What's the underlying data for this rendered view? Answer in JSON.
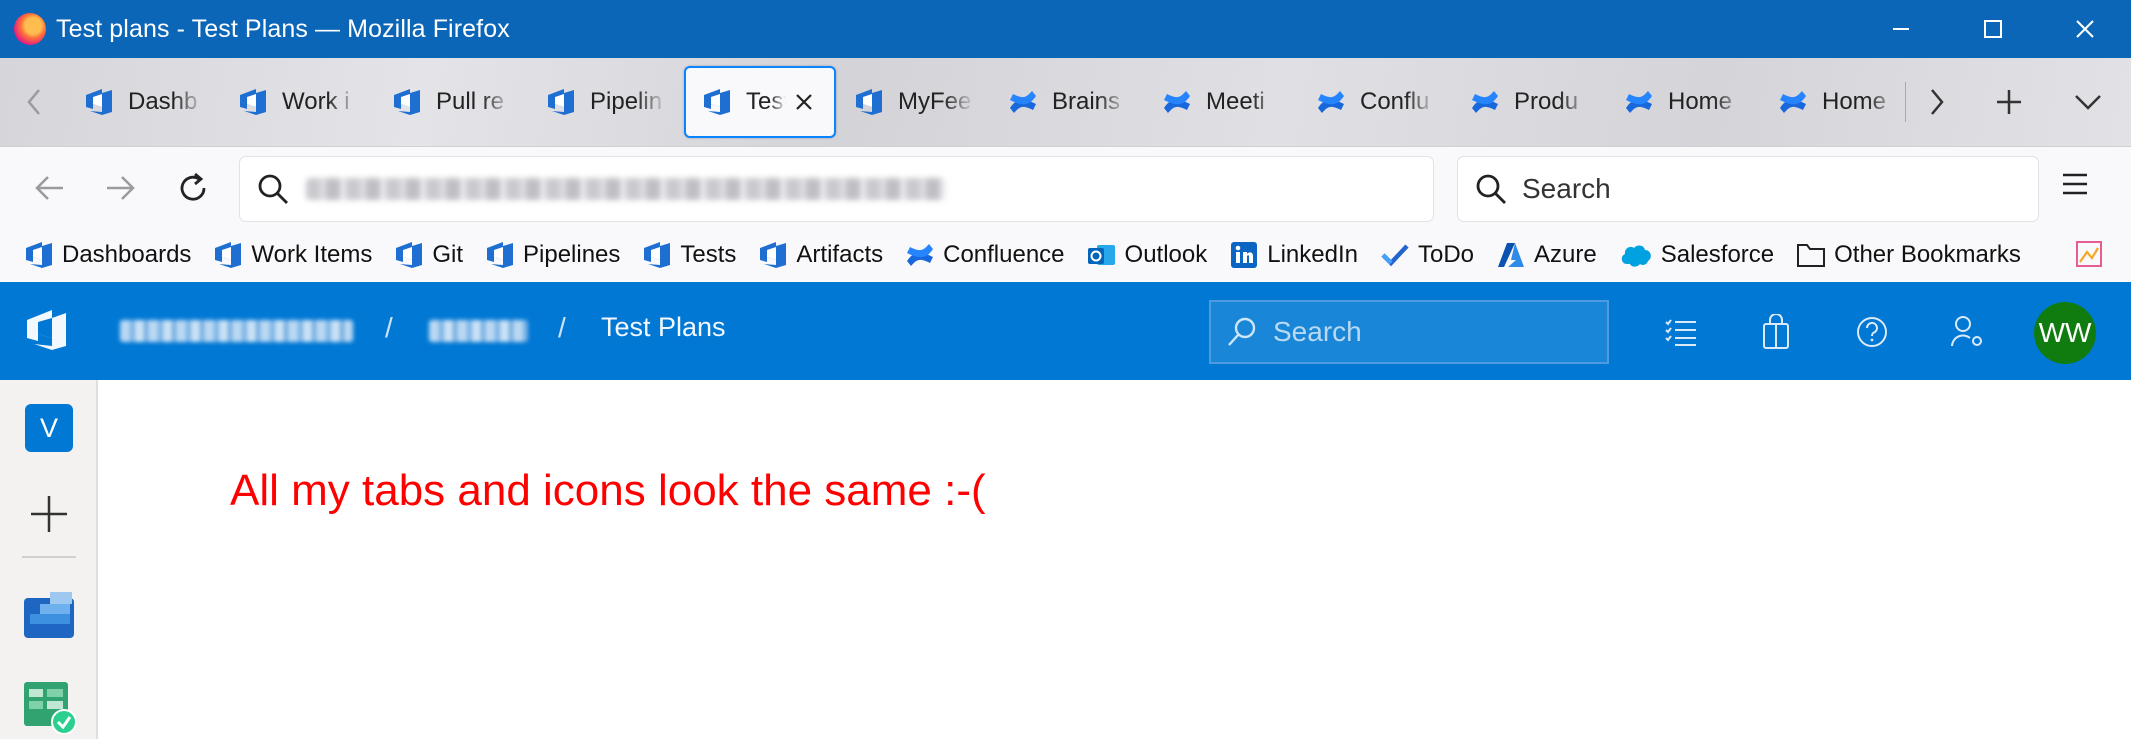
{
  "window": {
    "title": "Test plans - Test Plans — Mozilla Firefox"
  },
  "tabs": [
    {
      "label": "Dashb",
      "icon": "azure-devops-icon",
      "active": false
    },
    {
      "label": "Work i",
      "icon": "azure-devops-icon",
      "active": false
    },
    {
      "label": "Pull re",
      "icon": "azure-devops-icon",
      "active": false
    },
    {
      "label": "Pipelin",
      "icon": "azure-devops-icon",
      "active": false
    },
    {
      "label": "Test",
      "icon": "azure-devops-icon",
      "active": true
    },
    {
      "label": "MyFee",
      "icon": "azure-devops-icon",
      "active": false
    },
    {
      "label": "Brains",
      "icon": "confluence-icon",
      "active": false
    },
    {
      "label": "Meeti",
      "icon": "confluence-icon",
      "active": false
    },
    {
      "label": "Conflu",
      "icon": "confluence-icon",
      "active": false
    },
    {
      "label": "Produ",
      "icon": "confluence-icon",
      "active": false
    },
    {
      "label": "Home",
      "icon": "confluence-icon",
      "active": false
    },
    {
      "label": "Home",
      "icon": "confluence-icon",
      "active": false
    }
  ],
  "navbar": {
    "search_placeholder": "Search"
  },
  "bookmarks": [
    {
      "label": "Dashboards",
      "icon": "azure-devops-icon"
    },
    {
      "label": "Work Items",
      "icon": "azure-devops-icon"
    },
    {
      "label": "Git",
      "icon": "azure-devops-icon"
    },
    {
      "label": "Pipelines",
      "icon": "azure-devops-icon"
    },
    {
      "label": "Tests",
      "icon": "azure-devops-icon"
    },
    {
      "label": "Artifacts",
      "icon": "azure-devops-icon"
    },
    {
      "label": "Confluence",
      "icon": "confluence-icon"
    },
    {
      "label": "Outlook",
      "icon": "outlook-icon"
    },
    {
      "label": "LinkedIn",
      "icon": "linkedin-icon"
    },
    {
      "label": "ToDo",
      "icon": "todo-icon"
    },
    {
      "label": "Azure",
      "icon": "azure-icon"
    },
    {
      "label": "Salesforce",
      "icon": "salesforce-icon"
    },
    {
      "label": "Other Bookmarks",
      "icon": "folder-icon"
    }
  ],
  "ado": {
    "breadcrumb_sep": "/",
    "current_page": "Test Plans",
    "search_placeholder": "Search",
    "avatar_initials": "WW"
  },
  "rail": {
    "org_initial": "V"
  },
  "main": {
    "message": "All my tabs and icons look the same :-("
  },
  "colors": {
    "firefox_titlebar": "#0c66b8",
    "ado_header": "#0078d4",
    "avatar": "#107c10",
    "message": "#ff0000",
    "active_tab_border": "#0a84ff"
  }
}
